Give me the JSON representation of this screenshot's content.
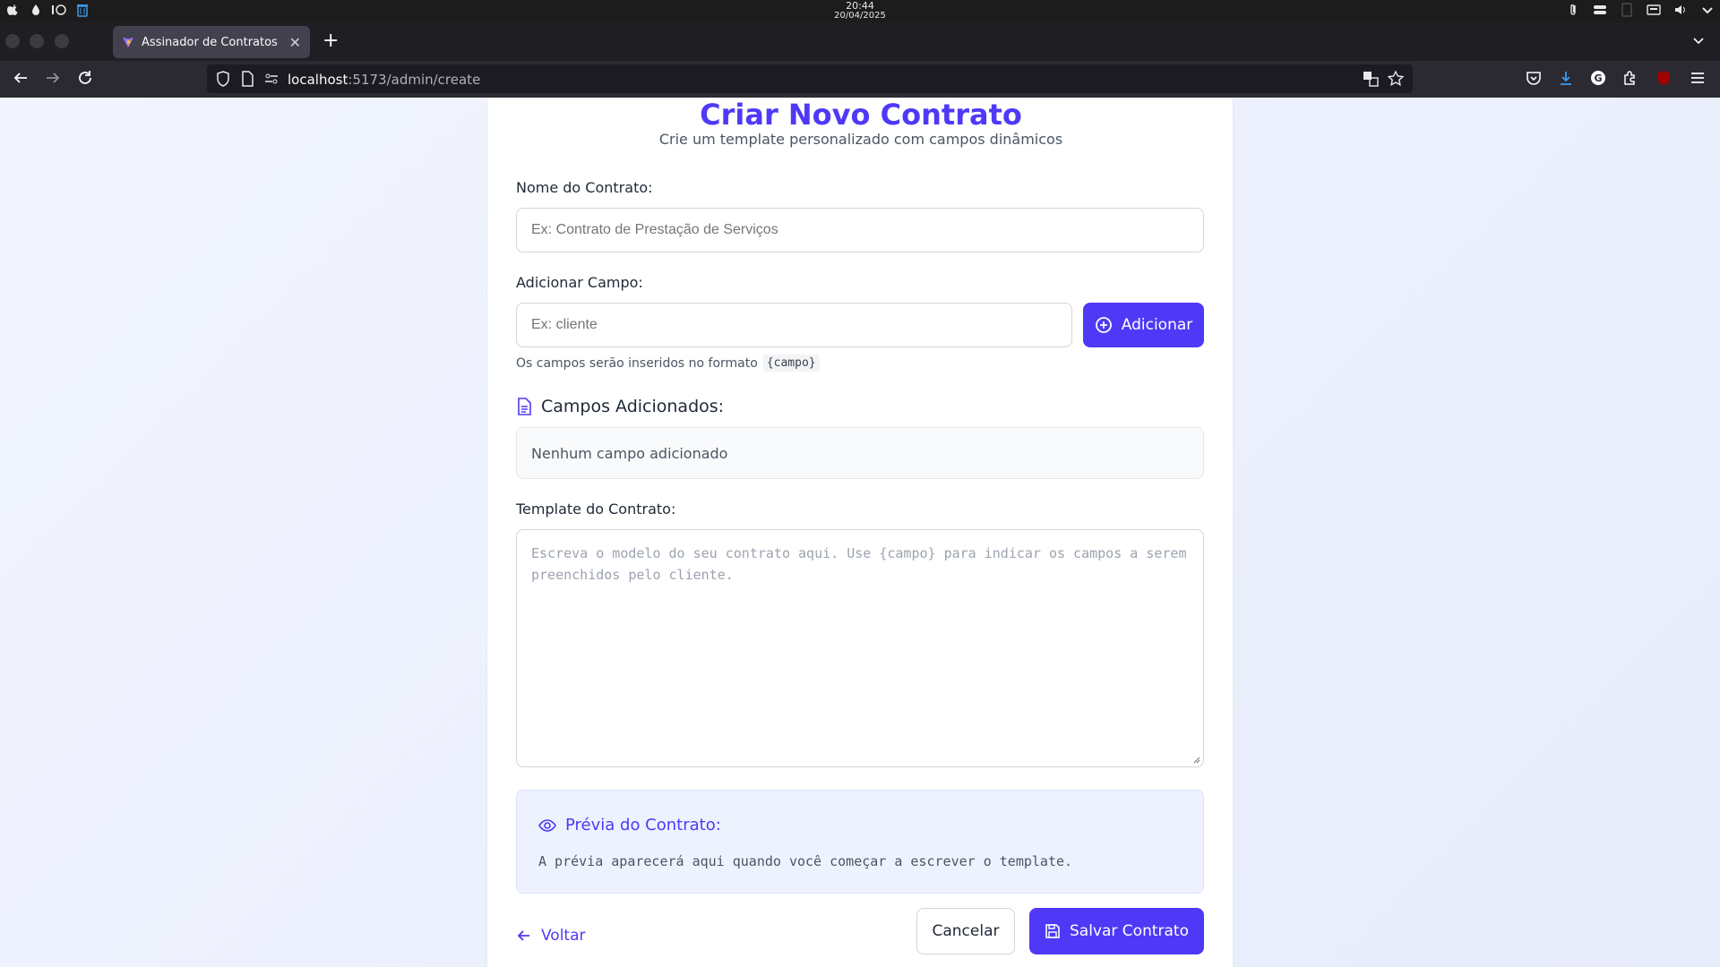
{
  "os": {
    "time": "20:44",
    "date": "20/04/2025"
  },
  "browser": {
    "tab_title": "Assinador de Contratos",
    "url_host": "localhost",
    "url_path": ":5173/admin/create"
  },
  "page": {
    "title": "Criar Novo Contrato",
    "subtitle": "Crie um template personalizado com campos dinâmicos",
    "contract_name": {
      "label": "Nome do Contrato:",
      "placeholder": "Ex: Contrato de Prestação de Serviços"
    },
    "add_field": {
      "label": "Adicionar Campo:",
      "placeholder": "Ex: cliente",
      "button_label": "Adicionar",
      "hint_text": "Os campos serão inseridos no formato",
      "hint_code": "{campo}"
    },
    "added_fields": {
      "heading": "Campos Adicionados:",
      "empty_text": "Nenhum campo adicionado"
    },
    "template": {
      "label": "Template do Contrato:",
      "placeholder": "Escreva o modelo do seu contrato aqui. Use {campo} para indicar os campos a serem preenchidos pelo cliente."
    },
    "preview": {
      "heading": "Prévia do Contrato:",
      "empty_text": "A prévia aparecerá aqui quando você começar a escrever o template."
    },
    "actions": {
      "back_label": "Voltar",
      "cancel_label": "Cancelar",
      "save_label": "Salvar Contrato"
    }
  },
  "colors": {
    "accent": "#4f39f6",
    "page_bg": "#eef2ff"
  }
}
